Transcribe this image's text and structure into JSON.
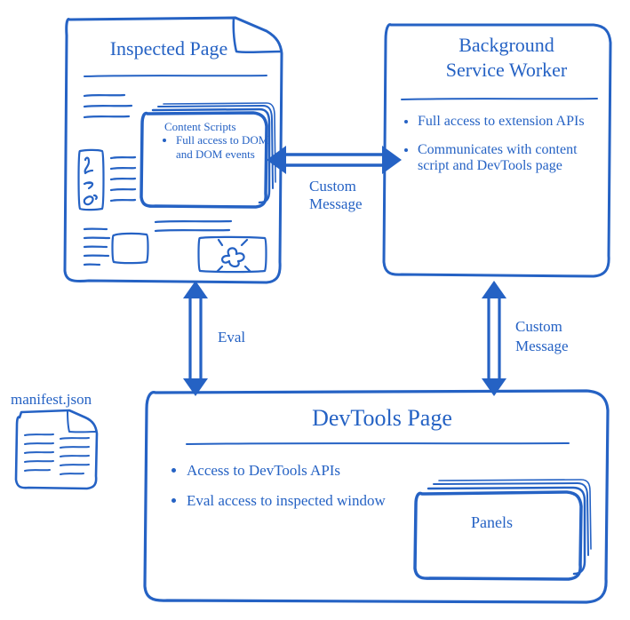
{
  "boxes": {
    "inspected": {
      "title": "Inspected Page",
      "content_scripts_label": "Content Scripts",
      "content_scripts_bullet": "Full access to DOM and DOM events"
    },
    "background": {
      "title_line1": "Background",
      "title_line2": "Service Worker",
      "bullets": [
        "Full access to extension APIs",
        "Communicates with content script and DevTools page"
      ]
    },
    "devtools": {
      "title": "DevTools Page",
      "bullets": [
        "Access to DevTools APIs",
        "Eval access to inspected window"
      ],
      "panels_label": "Panels"
    },
    "manifest": {
      "label": "manifest.json"
    }
  },
  "arrows": {
    "top_horizontal": "Custom Message",
    "left_vertical": "Eval",
    "right_vertical_line1": "Custom",
    "right_vertical_line2": "Message"
  },
  "colors": {
    "ink": "#2562c4"
  }
}
